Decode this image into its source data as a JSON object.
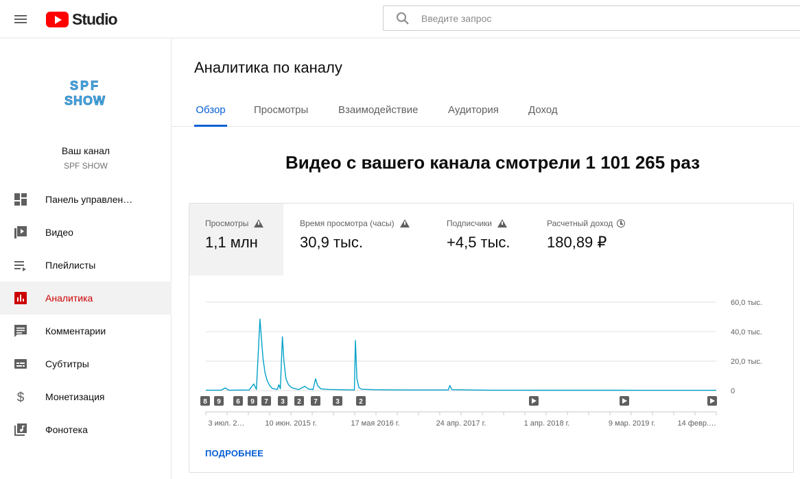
{
  "app": {
    "logo_text": "Studio"
  },
  "search": {
    "placeholder": "Введите запрос"
  },
  "channel": {
    "logo_text": "SPF SHOW",
    "title": "Ваш канал",
    "name": "SPF SHOW"
  },
  "sidebar": {
    "items": [
      {
        "label": "Панель управлен…",
        "icon": "dashboard-icon"
      },
      {
        "label": "Видео",
        "icon": "video-icon"
      },
      {
        "label": "Плейлисты",
        "icon": "playlist-icon"
      },
      {
        "label": "Аналитика",
        "icon": "analytics-icon",
        "active": true
      },
      {
        "label": "Комментарии",
        "icon": "comments-icon"
      },
      {
        "label": "Субтитры",
        "icon": "subtitles-icon"
      },
      {
        "label": "Монетизация",
        "icon": "dollar-icon"
      },
      {
        "label": "Фонотека",
        "icon": "audio-library-icon"
      }
    ]
  },
  "main": {
    "title": "Аналитика по каналу",
    "tabs": [
      {
        "label": "Обзор",
        "active": true
      },
      {
        "label": "Просмотры"
      },
      {
        "label": "Взаимодействие"
      },
      {
        "label": "Аудитория"
      },
      {
        "label": "Доход"
      }
    ],
    "headline": "Видео с вашего канала смотрели 1 101 265 раз",
    "metrics": [
      {
        "label": "Просмотры",
        "value": "1,1 млн",
        "icon": "warning-icon",
        "active": true
      },
      {
        "label": "Время просмотра (часы)",
        "value": "30,9 тыс.",
        "icon": "warning-icon"
      },
      {
        "label": "Подписчики",
        "value": "+4,5 тыс.",
        "icon": "warning-icon"
      },
      {
        "label": "Расчетный доход",
        "value": "180,89 ₽",
        "icon": "clock-icon"
      }
    ],
    "more_link": "ПОДРОБНЕЕ"
  },
  "colors": {
    "accent": "#065fd4",
    "brand_red": "#ff0000",
    "active_nav": "#cc0000",
    "line": "#00a0c8"
  },
  "chart_data": {
    "type": "line",
    "x_tick_labels": [
      "3 июл. 2…",
      "10 июн. 2015 г.",
      "17 мая 2016 г.",
      "24 апр. 2017 г.",
      "1 апр. 2018 г.",
      "9 мар. 2019 г.",
      "14 февр.…"
    ],
    "y_tick_labels": [
      "60,0 тыс.",
      "40,0 тыс.",
      "20,0 тыс.",
      "0"
    ],
    "ylim": [
      0,
      60000
    ],
    "x_range": [
      0,
      1
    ],
    "grid": true,
    "series": [
      {
        "points": [
          [
            0.0,
            300
          ],
          [
            0.03,
            300
          ],
          [
            0.038,
            1800
          ],
          [
            0.045,
            300
          ],
          [
            0.085,
            400
          ],
          [
            0.094,
            4500
          ],
          [
            0.099,
            800
          ],
          [
            0.106,
            48500
          ],
          [
            0.109,
            35000
          ],
          [
            0.112,
            22000
          ],
          [
            0.116,
            12000
          ],
          [
            0.12,
            7000
          ],
          [
            0.125,
            3500
          ],
          [
            0.13,
            1500
          ],
          [
            0.14,
            800
          ],
          [
            0.143,
            4000
          ],
          [
            0.146,
            1200
          ],
          [
            0.15,
            36500
          ],
          [
            0.153,
            20000
          ],
          [
            0.157,
            8000
          ],
          [
            0.162,
            4000
          ],
          [
            0.168,
            2000
          ],
          [
            0.176,
            1200
          ],
          [
            0.182,
            700
          ],
          [
            0.194,
            3000
          ],
          [
            0.2,
            1200
          ],
          [
            0.21,
            700
          ],
          [
            0.215,
            8000
          ],
          [
            0.219,
            3500
          ],
          [
            0.225,
            1200
          ],
          [
            0.24,
            800
          ],
          [
            0.26,
            600
          ],
          [
            0.28,
            500
          ],
          [
            0.291,
            400
          ],
          [
            0.293,
            34000
          ],
          [
            0.296,
            8000
          ],
          [
            0.3,
            2000
          ],
          [
            0.305,
            900
          ],
          [
            0.33,
            600
          ],
          [
            0.36,
            500
          ],
          [
            0.4,
            400
          ],
          [
            0.45,
            400
          ],
          [
            0.475,
            400
          ],
          [
            0.478,
            3500
          ],
          [
            0.482,
            600
          ],
          [
            0.52,
            400
          ],
          [
            0.56,
            300
          ],
          [
            0.6,
            300
          ],
          [
            0.65,
            250
          ],
          [
            0.7,
            250
          ],
          [
            0.75,
            250
          ],
          [
            0.8,
            250
          ],
          [
            0.85,
            200
          ],
          [
            0.9,
            200
          ],
          [
            0.95,
            200
          ],
          [
            1.0,
            200
          ]
        ]
      }
    ],
    "event_markers": [
      "8",
      "9",
      "6",
      "9",
      "7",
      "3",
      "2",
      "7",
      "3",
      "2"
    ],
    "video_markers": 3
  }
}
